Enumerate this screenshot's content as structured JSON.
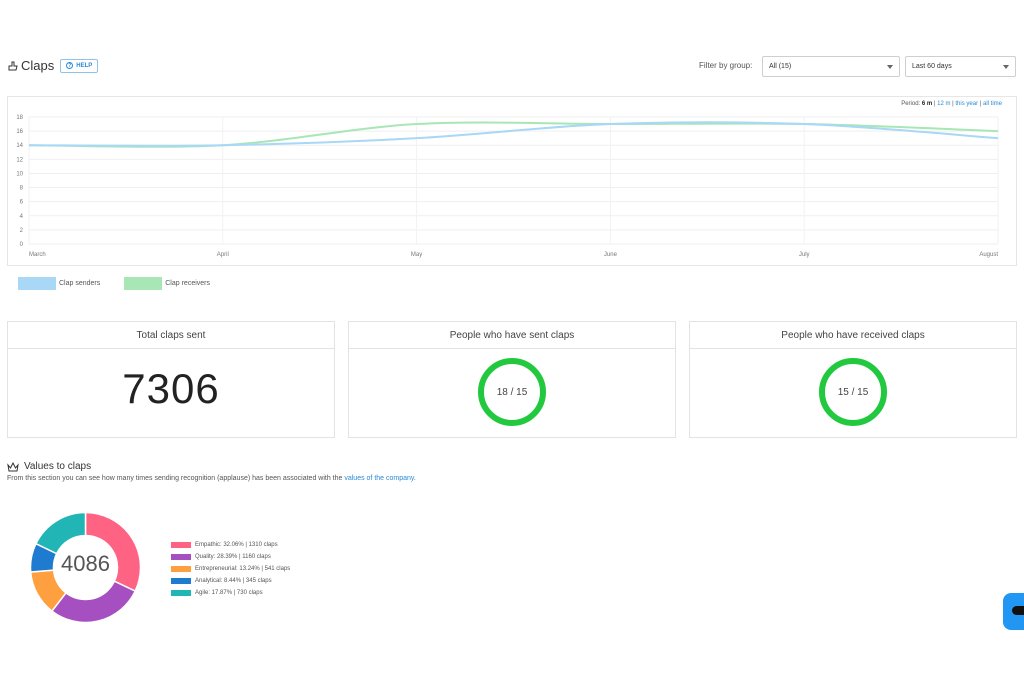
{
  "header": {
    "title": "Claps",
    "help_label": "HELP",
    "filter_label": "Filter by group:",
    "group_select": "All (15)",
    "date_select": "Last 60 days"
  },
  "period": {
    "label": "Period:",
    "current": "6 m",
    "sep1": " | ",
    "opt_12m": "12 m",
    "sep2": " | ",
    "opt_year": "this year",
    "sep3": " | ",
    "opt_all": "all time"
  },
  "chart_data": {
    "type": "line",
    "x": [
      "March",
      "April",
      "May",
      "June",
      "July",
      "August"
    ],
    "ylim": [
      0,
      18
    ],
    "yticks": [
      0,
      2,
      4,
      6,
      8,
      10,
      12,
      14,
      16,
      18
    ],
    "grid": true,
    "legend_position": "bottom-left",
    "series": [
      {
        "name": "Clap senders",
        "values": [
          14,
          14,
          15,
          17,
          17,
          15
        ],
        "color": "#a8d8f5"
      },
      {
        "name": "Clap receivers",
        "values": [
          14,
          14,
          17,
          17,
          17,
          16
        ],
        "color": "#a8e6b6"
      }
    ]
  },
  "cards": {
    "total": {
      "title": "Total claps sent",
      "value": "7306"
    },
    "senders": {
      "title": "People who have sent claps",
      "value": "18 / 15"
    },
    "receivers": {
      "title": "People who have received claps",
      "value": "15 / 15"
    }
  },
  "values": {
    "title": "Values to claps",
    "desc_prefix": "From this section you can see how many times sending recognition (applause) has been associated with the ",
    "desc_link": "values of the company",
    "desc_suffix": ".",
    "total": "4086",
    "slices": [
      {
        "label": "Empathic: 32.06% | 1310 claps",
        "value": 1310,
        "color": "#ff6384"
      },
      {
        "label": "Quality: 28.39% | 1160 claps",
        "value": 1160,
        "color": "#a64fc0"
      },
      {
        "label": "Entrepreneurial: 13.24% | 541 claps",
        "value": 541,
        "color": "#ffa040"
      },
      {
        "label": "Analytical: 8.44% | 345 claps",
        "value": 345,
        "color": "#1f7bd0"
      },
      {
        "label": "Agile: 17.87% | 730 claps",
        "value": 730,
        "color": "#22b5b5"
      }
    ]
  },
  "icons": {
    "claps": "clap-hand-icon",
    "help": "question-circle-icon",
    "values": "crown-icon",
    "chat": "chat-icon"
  }
}
